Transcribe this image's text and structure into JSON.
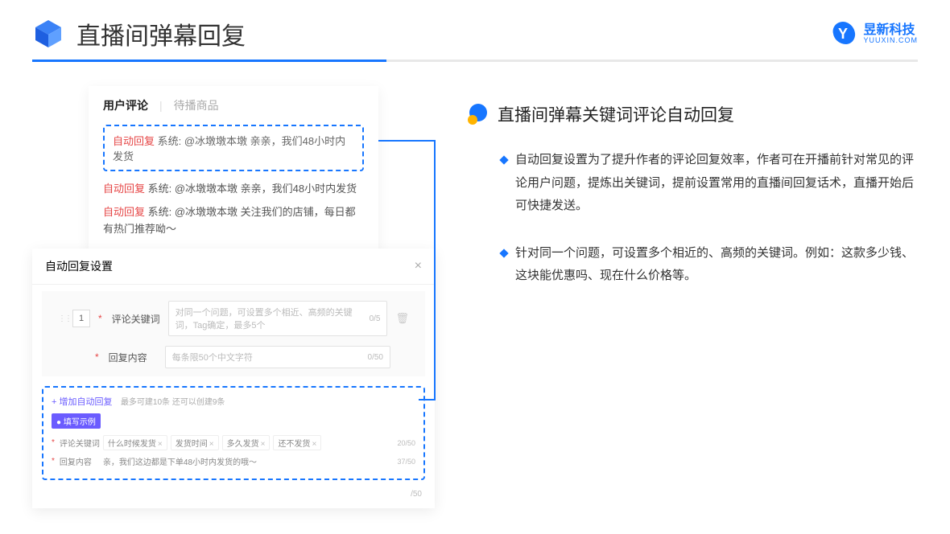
{
  "header": {
    "title": "直播间弹幕回复",
    "brand_cn": "昱新科技",
    "brand_en": "YUUXIN.COM"
  },
  "comments_panel": {
    "tab_active": "用户评论",
    "tab_inactive": "待播商品",
    "highlight_tag": "自动回复",
    "highlight_text": "系统: @冰墩墩本墩 亲亲，我们48小时内发货",
    "line1_tag": "自动回复",
    "line1_text": "系统: @冰墩墩本墩 亲亲，我们48小时内发货",
    "line2_tag": "自动回复",
    "line2_text": "系统: @冰墩墩本墩 关注我们的店铺，每日都有热门推荐呦～"
  },
  "settings_panel": {
    "title": "自动回复设置",
    "index": "1",
    "kw_label": "评论关键词",
    "kw_placeholder": "对同一个问题，可设置多个相近、高频的关键词，Tag确定，最多5个",
    "kw_counter": "0/5",
    "content_label": "回复内容",
    "content_placeholder": "每条限50个中文字符",
    "content_counter": "0/50",
    "add_link": "+ 增加自动回复",
    "add_hint": "最多可建10条 还可以创建9条",
    "example_badge": "● 填写示例",
    "ex_kw_label": "评论关键词",
    "ex_tags": [
      "什么时候发货",
      "发货时间",
      "多久发货",
      "还不发货"
    ],
    "ex_kw_counter": "20/50",
    "ex_content_label": "回复内容",
    "ex_content_text": "亲，我们这边都是下单48小时内发货的哦～",
    "ex_content_counter": "37/50",
    "outer_counter": "/50"
  },
  "right": {
    "section_title": "直播间弹幕关键词评论自动回复",
    "bullet1": "自动回复设置为了提升作者的评论回复效率，作者可在开播前针对常见的评论用户问题，提炼出关键词，提前设置常用的直播间回复话术，直播开始后可快捷发送。",
    "bullet2": "针对同一个问题，可设置多个相近的、高频的关键词。例如：这款多少钱、这块能优惠吗、现在什么价格等。"
  }
}
